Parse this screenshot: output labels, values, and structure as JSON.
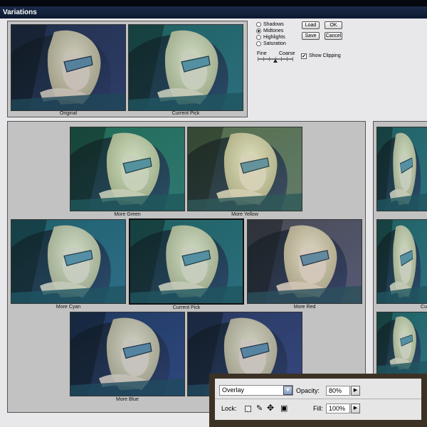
{
  "window": {
    "title": "Variations"
  },
  "top_thumbs": [
    {
      "caption": "Original",
      "tint": "#2f3e6a"
    },
    {
      "caption": "Current Pick",
      "tint": "#2a8c8a"
    }
  ],
  "options": {
    "radios": [
      {
        "label": "Shadows",
        "selected": false
      },
      {
        "label": "Midtones",
        "selected": true
      },
      {
        "label": "Highlights",
        "selected": false
      },
      {
        "label": "Saturation",
        "selected": false
      }
    ],
    "fine_label": "Fine",
    "coarse_label": "Coarse",
    "slider_level": 0.5,
    "show_clipping_label": "Show Clipping",
    "show_clipping_checked": true
  },
  "buttons": {
    "load": "Load",
    "ok": "OK",
    "save": "Save",
    "cancel": "Cancel"
  },
  "grid": [
    {
      "caption": "More Green",
      "tint": "#2f9a78"
    },
    {
      "caption": "More Yellow",
      "tint": "#7fa06a"
    },
    {
      "caption": "More Cyan",
      "tint": "#2c8a9a"
    },
    {
      "caption": "Current Pick",
      "tint": "#2a8c8a"
    },
    {
      "caption": "More Red",
      "tint": "#6d6a7a"
    },
    {
      "caption": "More Blue",
      "tint": "#2d4f8a"
    },
    {
      "caption": "",
      "tint": "#3a4d8a"
    }
  ],
  "right_column": {
    "caption": "Cu",
    "tint": "#2a8c8a"
  },
  "layers": {
    "blend_mode": "Overlay",
    "opacity_label": "Opacity:",
    "opacity_value": "80%",
    "lock_label": "Lock:",
    "fill_label": "Fill:",
    "fill_value": "100%"
  },
  "colors": {
    "panel": "#c2c2c2",
    "dialog": "#e8e7ea",
    "titlebar": "#12213c",
    "layers_frame": "#3b3225"
  }
}
